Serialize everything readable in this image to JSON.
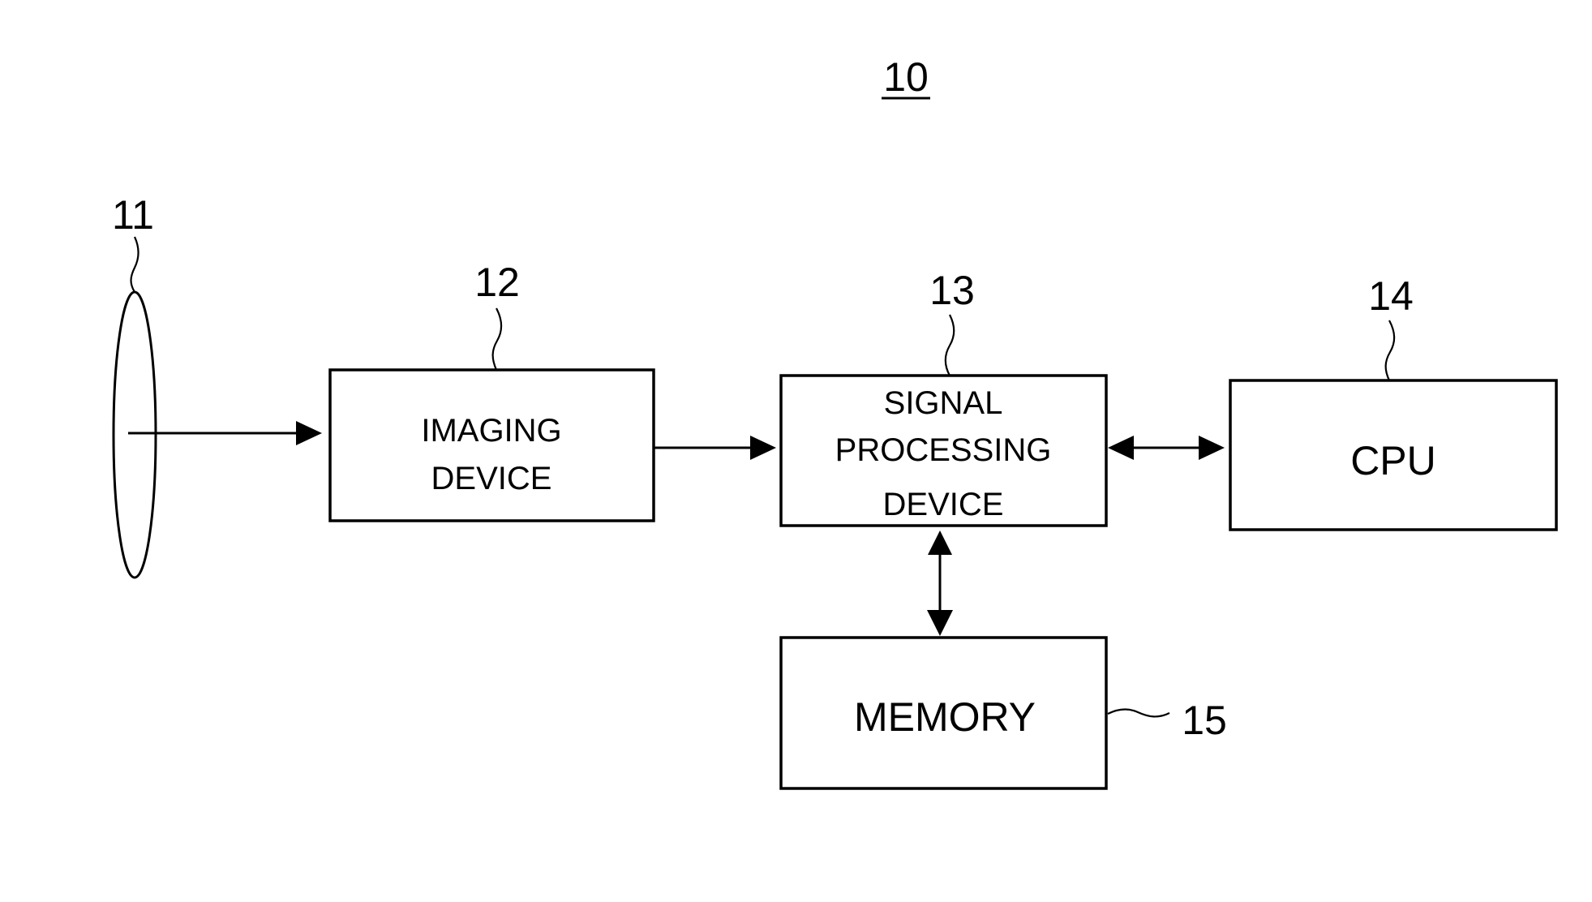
{
  "figure": {
    "reference": "10"
  },
  "components": {
    "lens": {
      "ref": "11"
    },
    "imaging": {
      "ref": "12",
      "lines": [
        "IMAGING",
        "DEVICE"
      ]
    },
    "signal": {
      "ref": "13",
      "lines": [
        "SIGNAL",
        "PROCESSING",
        "DEVICE"
      ]
    },
    "cpu": {
      "ref": "14",
      "lines": [
        "CPU"
      ]
    },
    "memory": {
      "ref": "15",
      "lines": [
        "MEMORY"
      ]
    }
  },
  "connections": [
    {
      "from": "lens",
      "to": "imaging",
      "direction": "one-way"
    },
    {
      "from": "imaging",
      "to": "signal",
      "direction": "one-way"
    },
    {
      "from": "signal",
      "to": "cpu",
      "direction": "two-way"
    },
    {
      "from": "signal",
      "to": "memory",
      "direction": "two-way"
    }
  ]
}
